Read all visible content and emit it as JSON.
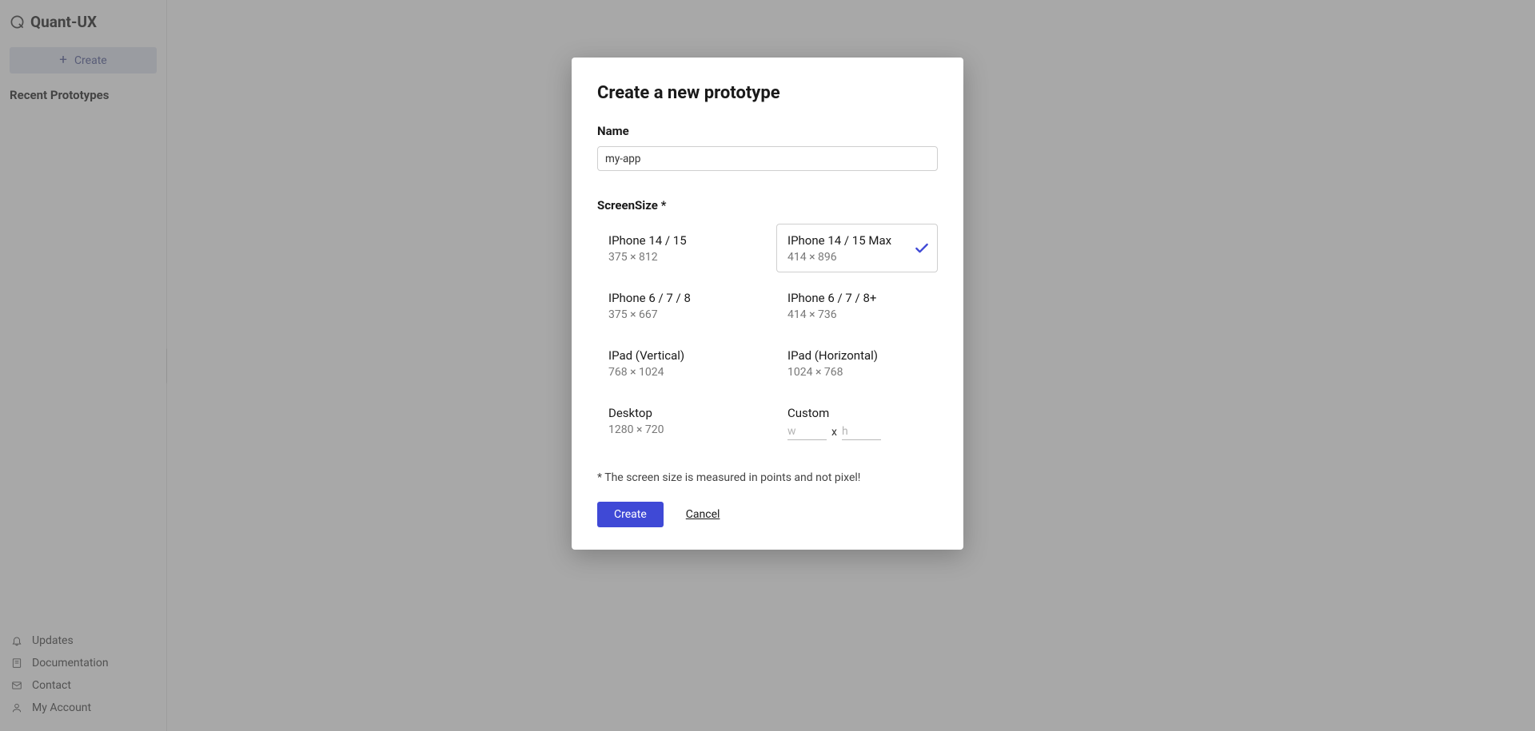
{
  "brand": "Quant-UX",
  "sidebar": {
    "create_label": "Create",
    "recent_heading": "Recent Prototypes",
    "bottom_links": [
      {
        "label": "Updates"
      },
      {
        "label": "Documentation"
      },
      {
        "label": "Contact"
      },
      {
        "label": "My Account"
      }
    ]
  },
  "modal": {
    "title": "Create a new prototype",
    "name_label": "Name",
    "name_value": "my-app",
    "screensize_label": "ScreenSize *",
    "sizes": [
      {
        "name": "IPhone 14 / 15",
        "dims": "375 × 812",
        "selected": false
      },
      {
        "name": "IPhone 14 / 15 Max",
        "dims": "414 × 896",
        "selected": true
      },
      {
        "name": "IPhone 6 / 7 / 8",
        "dims": "375 × 667",
        "selected": false
      },
      {
        "name": "IPhone 6 / 7 / 8+",
        "dims": "414 × 736",
        "selected": false
      },
      {
        "name": "IPad (Vertical)",
        "dims": "768 × 1024",
        "selected": false
      },
      {
        "name": "IPad (Horizontal)",
        "dims": "1024 × 768",
        "selected": false
      },
      {
        "name": "Desktop",
        "dims": "1280 × 720",
        "selected": false
      }
    ],
    "custom_label": "Custom",
    "custom_w_placeholder": "w",
    "custom_h_placeholder": "h",
    "custom_x": "x",
    "footnote": "* The screen size is measured in points and not pixel!",
    "create_button": "Create",
    "cancel_button": "Cancel"
  }
}
